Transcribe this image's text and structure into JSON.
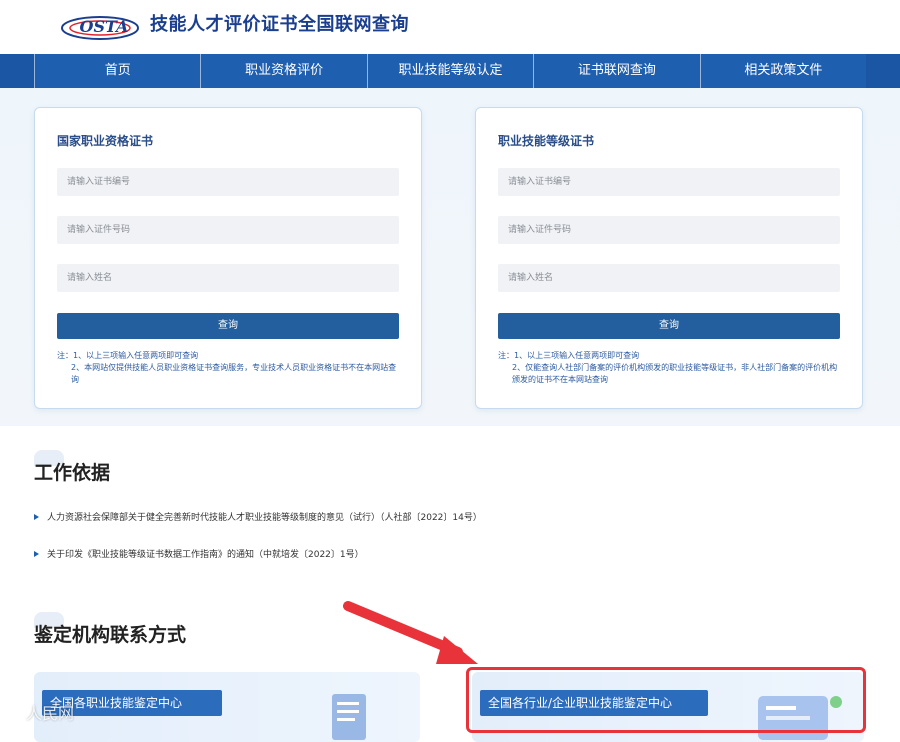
{
  "header": {
    "logo_text": "OSTA",
    "site_title": "技能人才评价证书全国联网查询"
  },
  "nav": {
    "items": [
      {
        "label": "首页"
      },
      {
        "label": "职业资格评价"
      },
      {
        "label": "职业技能等级认定"
      },
      {
        "label": "证书联网查询"
      },
      {
        "label": "相关政策文件"
      }
    ]
  },
  "cards": {
    "left": {
      "title": "国家职业资格证书",
      "cert_placeholder": "请输入证书编号",
      "id_placeholder": "请输入证件号码",
      "name_placeholder": "请输入姓名",
      "button": "查询",
      "note_1": "注：1、以上三项输入任意两项即可查询",
      "note_2": "2、本网站仅提供技能人员职业资格证书查询服务，专业技术人员职业资格证书不在本网站查询"
    },
    "right": {
      "title": "职业技能等级证书",
      "cert_placeholder": "请输入证书编号",
      "id_placeholder": "请输入证件号码",
      "name_placeholder": "请输入姓名",
      "button": "查询",
      "note_1": "注：1、以上三项输入任意两项即可查询",
      "note_2": "2、仅能查询人社部门备案的评价机构颁发的职业技能等级证书，非人社部门备案的评价机构颁发的证书不在本网站查询"
    }
  },
  "work_basis": {
    "title": "工作依据",
    "items": [
      "人力资源社会保障部关于健全完善新时代技能人才职业技能等级制度的意见（试行）（人社部〔2022〕14号）",
      "关于印发《职业技能等级证书数据工作指南》的通知（中就培发〔2022〕1号）"
    ]
  },
  "contacts": {
    "title": "鉴定机构联系方式",
    "left_label": "全国各职业技能鉴定中心",
    "right_label": "全国各行业/企业职业技能鉴定中心"
  },
  "watermark": {
    "text": "人民网"
  },
  "colors": {
    "nav_bg": "#1f5fb0",
    "button_bg": "#235f9f",
    "title_blue": "#1b3f8f",
    "highlight_red": "#e8333a"
  }
}
